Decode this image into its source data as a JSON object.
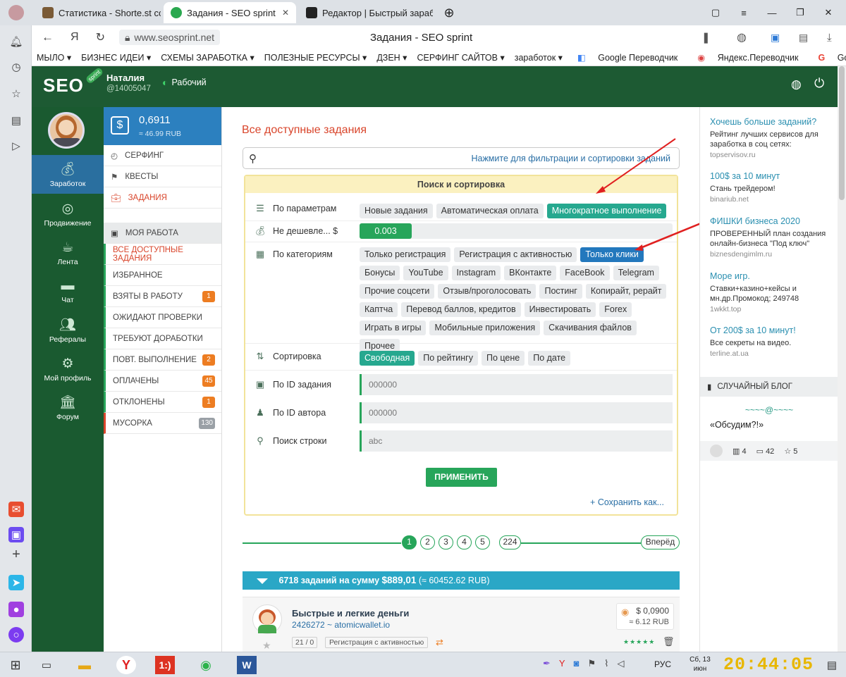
{
  "browser": {
    "tabs": [
      {
        "title": "Статистика - Shorte.st ссы"
      },
      {
        "title": "Задания - SEO sprint"
      },
      {
        "title": "Редактор | Быстрый заработ"
      }
    ],
    "url": "www.seosprint.net",
    "page_title": "Задания - SEO sprint",
    "bookmarks": [
      "МЫЛО ▾",
      "БИЗНЕС ИДЕИ ▾",
      "СХЕМЫ ЗАРАБОТКА ▾",
      "ПОЛЕЗНЫЕ РЕСУРСЫ ▾",
      "ДЗЕН ▾",
      "СЕРФИНГ САЙТОВ ▾",
      "заработок ▾",
      "Google Переводчик",
      "Яндекс.Переводчик",
      "Google"
    ]
  },
  "header": {
    "logo": "SEO",
    "logo_badge": "sprint",
    "user_name": "Наталия",
    "user_id": "@14005047",
    "status": "Рабочий"
  },
  "left_nav": [
    {
      "label": "Заработок",
      "icon": "money-bag-icon"
    },
    {
      "label": "Продвижение",
      "icon": "promote-icon"
    },
    {
      "label": "Лента",
      "icon": "coffee-icon"
    },
    {
      "label": "Чат",
      "icon": "chat-icon"
    },
    {
      "label": "Рефералы",
      "icon": "users-icon"
    },
    {
      "label": "Мой профиль",
      "icon": "gear-icon"
    },
    {
      "label": "Форум",
      "icon": "forum-icon"
    }
  ],
  "balance": {
    "usd": "0,6911",
    "rub": "≈ 46.99 RUB"
  },
  "menu": {
    "top": [
      "СЕРФИНГ",
      "КВЕСТЫ",
      "ЗАДАНИЯ"
    ],
    "section": "МОЯ РАБОТА",
    "items": [
      {
        "label": "ВСЕ ДОСТУПНЫЕ ЗАДАНИЯ",
        "count": ""
      },
      {
        "label": "ИЗБРАННОЕ",
        "count": ""
      },
      {
        "label": "ВЗЯТЫ В РАБОТУ",
        "count": "1"
      },
      {
        "label": "ОЖИДАЮТ ПРОВЕРКИ",
        "count": ""
      },
      {
        "label": "ТРЕБУЮТ ДОРАБОТКИ",
        "count": ""
      },
      {
        "label": "ПОВТ. ВЫПОЛНЕНИЕ",
        "count": "2"
      },
      {
        "label": "ОПЛАЧЕНЫ",
        "count": "45"
      },
      {
        "label": "ОТКЛОНЕНЫ",
        "count": "1"
      },
      {
        "label": "МУСОРКА",
        "count": "130"
      }
    ]
  },
  "main": {
    "title": "Все доступные задания",
    "filter_hint": "Нажмите для фильтрации и сортировки заданий",
    "panel_title": "Поиск и сортировка",
    "params_label": "По параметрам",
    "params": [
      "Новые задания",
      "Автоматическая оплата",
      "Многократное выполнение"
    ],
    "min_price_label": "Не дешевле... $",
    "min_price": "0.003",
    "categories_label": "По категориям",
    "categories": [
      "Только регистрация",
      "Регистрация с активностью",
      "Только клики",
      "Бонусы",
      "YouTube",
      "Instagram",
      "ВКонтакте",
      "FaceBook",
      "Telegram",
      "Прочие соцсети",
      "Отзыв/проголосовать",
      "Постинг",
      "Копирайт, рерайт",
      "Каптча",
      "Перевод баллов, кредитов",
      "Инвестировать",
      "Forex",
      "Играть в игры",
      "Мобильные приложения",
      "Скачивания файлов",
      "Прочее"
    ],
    "sort_label": "Сортировка",
    "sort": [
      "Свободная",
      "По рейтингу",
      "По цене",
      "По дате"
    ],
    "task_id_label": "По ID задания",
    "task_id_placeholder": "000000",
    "author_id_label": "По ID автора",
    "author_id_placeholder": "000000",
    "string_label": "Поиск строки",
    "string_placeholder": "abc",
    "apply": "ПРИМЕНИТЬ",
    "save_as": "+ Сохранить как...",
    "pages": [
      "1",
      "2",
      "3",
      "4",
      "5",
      "224"
    ],
    "next": "Вперёд",
    "summary_count": "6718 заданий на сумму",
    "summary_sum": "$889,01",
    "summary_rub": "(≈ 60452.62 RUB)",
    "task": {
      "title": "Быстрые и легкие деньги",
      "meta": "2426272 ~ atomicwallet.io",
      "price": "$ 0,0900",
      "price_rub": "≈ 6.12 RUB",
      "ratio": "21 / 0",
      "category": "Регистрация с активностью",
      "stars": "★★★★★"
    }
  },
  "right": {
    "ads": [
      {
        "title": "Хочешь больше заданий?",
        "desc": "Рейтинг лучших сервисов для заработка в соц сетях:",
        "url": "topservisov.ru"
      },
      {
        "title": "100$ за 10 минут",
        "desc": "Стань трейдером!",
        "url": "binariub.net"
      },
      {
        "title": "ФИШКИ бизнеса 2020",
        "desc": "ПРОВЕРЕННЫЙ план создания онлайн-бизнеса \"Под ключ\"",
        "url": "biznesdengimlm.ru"
      },
      {
        "title": "Море игр.",
        "desc": "Ставки+казино+кейсы и мн.др.Промокод; 249748",
        "url": "1wkkt.top"
      },
      {
        "title": "От 200$ за 10 минут!",
        "desc": "Все секреты на видео.",
        "url": "terline.at.ua"
      }
    ],
    "blog_header": "СЛУЧАЙНЫЙ БЛОГ",
    "blog_ornament": "~~~~@~~~~",
    "blog_title": "«Обсудим?!»",
    "blog_stats": [
      "4",
      "42",
      "5"
    ]
  },
  "taskbar": {
    "lang": "РУС",
    "date": "Сб, 13 июн",
    "time": "20:44:05"
  }
}
